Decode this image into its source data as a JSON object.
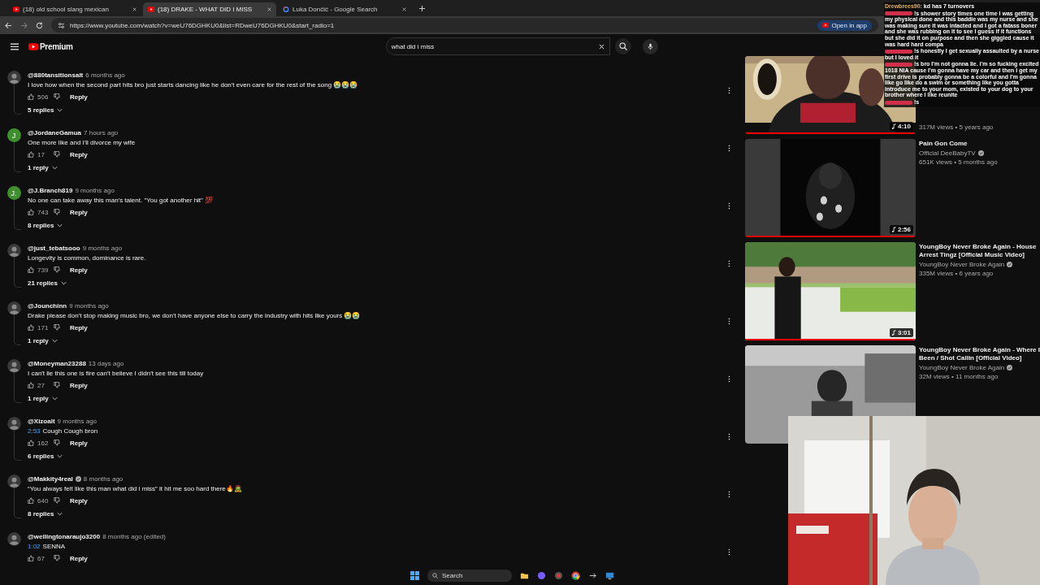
{
  "browser": {
    "tabs": [
      {
        "title": "(18) old school slang mexican",
        "selected": false,
        "kind": "youtube"
      },
      {
        "title": "(18) DRAKE - WHAT DID I MISS",
        "selected": true,
        "kind": "youtube"
      },
      {
        "title": "Luka Dončić - Google Search",
        "selected": false,
        "kind": "google"
      }
    ],
    "url": "https://www.youtube.com/watch?v=weU76DGHKU0&list=RDweU76DGHKU0&start_radio=1",
    "open_in_app": "Open in app"
  },
  "header": {
    "logo": "Premium",
    "search": {
      "value": "what did i miss"
    }
  },
  "comments": [
    {
      "handle": "@880tansitionsalt",
      "time": "6 months ago",
      "text": "I love how when the second part hits bro just starts dancing like he don't even care for the rest of the song 😭😭😭",
      "likes": "506",
      "reply": "Reply",
      "replies": "5 replies"
    },
    {
      "handle": "@JordaneGamua",
      "time": "7 hours ago",
      "avatar": {
        "kind": "letter",
        "letter": "J",
        "color": "#3f8f2f"
      },
      "text": "One more like and I'll divorce my wife",
      "likes": "17",
      "reply": "Reply",
      "replies": "1 reply"
    },
    {
      "handle": "@J.Branch819",
      "time": "9 months ago",
      "avatar": {
        "kind": "letter",
        "letter": "J.",
        "color": "#3f8f2f"
      },
      "text": "No one can take away this man's talent. \"You got another hit\" 💯",
      "likes": "743",
      "reply": "Reply",
      "replies": "8 replies"
    },
    {
      "handle": "@just_tebatsooo",
      "time": "9 months ago",
      "text": "Longevity is common, dominance is rare.",
      "likes": "739",
      "reply": "Reply",
      "replies": "21 replies"
    },
    {
      "handle": "@Jounchinn",
      "time": "9 months ago",
      "text": "Drake please don't stop making music bro, we don't have anyone else to carry the industry with hits like yours 😭😭",
      "likes": "171",
      "reply": "Reply",
      "replies": "1 reply"
    },
    {
      "handle": "@Moneyman23288",
      "time": "13 days ago",
      "text": "I can't lie this one is fire can't believe I didn't see this till today",
      "likes": "27",
      "reply": "Reply",
      "replies": "1 reply"
    },
    {
      "handle": "@Xizoalt",
      "time": "9 months ago",
      "timestamp": "2:53",
      "text": "Cough Cough bron",
      "likes": "162",
      "reply": "Reply",
      "replies": "6 replies"
    },
    {
      "handle": "@Makkity4real",
      "verified": true,
      "time": "8 months ago",
      "text": "“You always felt like this man what did i miss” it hit me soo hard there🔥🧟",
      "likes": "640",
      "reply": "Reply",
      "replies": "8 replies"
    },
    {
      "handle": "@wellingtonaraujo3200",
      "time": "8 months ago (edited)",
      "timestamp": "1:02",
      "text": "SENNA",
      "likes": "67",
      "reply": "Reply"
    }
  ],
  "up_next": [
    {
      "kind": "cabin",
      "duration": "4:10",
      "level": 1,
      "meta": "317M views • 5 years ago"
    },
    {
      "kind": "dark",
      "duration": "2:56",
      "level": 1,
      "title": "Pain Gon Come",
      "channel": "Official DeeBabyTV",
      "verified": true,
      "meta": "651K views • 5 months ago"
    },
    {
      "kind": "park",
      "duration": "3:01",
      "level": 1,
      "title": "YoungBoy Never Broke Again - House Arrest Tingz [Official Music Video]",
      "channel": "YoungBoy Never Broke Again",
      "verified": true,
      "meta": "335M views • 6 years ago"
    },
    {
      "kind": "grey",
      "title": "YoungBoy Never Broke Again - Where I Been / Shot Callin [Official Video]",
      "channel": "YoungBoy Never Broke Again",
      "verified": true,
      "meta": "32M views • 11 months ago"
    }
  ],
  "chat": [
    {
      "user": "Drewbrees90:",
      "color": "#f0b050",
      "text": "kd has 7 turnovers"
    },
    {
      "color": "#d0304a",
      "text": "!s shower story times one time I was getting my physical done and this baddie was my nurse and she was making sure it was intacted and I got a fatass boner and she was rubbing on it to see I guess if it functions but she did it on purpose and then she giggled cause it was hard hard compa"
    },
    {
      "color": "#d0304a",
      "text": "!s honestly I get sexually assaulted by a nurse but I loved it"
    },
    {
      "color": "#d0304a",
      "text": "!s bro I'm not gonna lie. I'm so fucking excited 1018 NIA cause I'm gonna have my car and then I get my first drive is probably gonna be a colorful and I'm gonna like go like do a swim or something like you gotta introduce me to your mom, existed to your dog to your brother where I like reunite"
    },
    {
      "color": "#d0304a",
      "text": "!s"
    }
  ],
  "taskbar": {
    "search": "Search"
  }
}
